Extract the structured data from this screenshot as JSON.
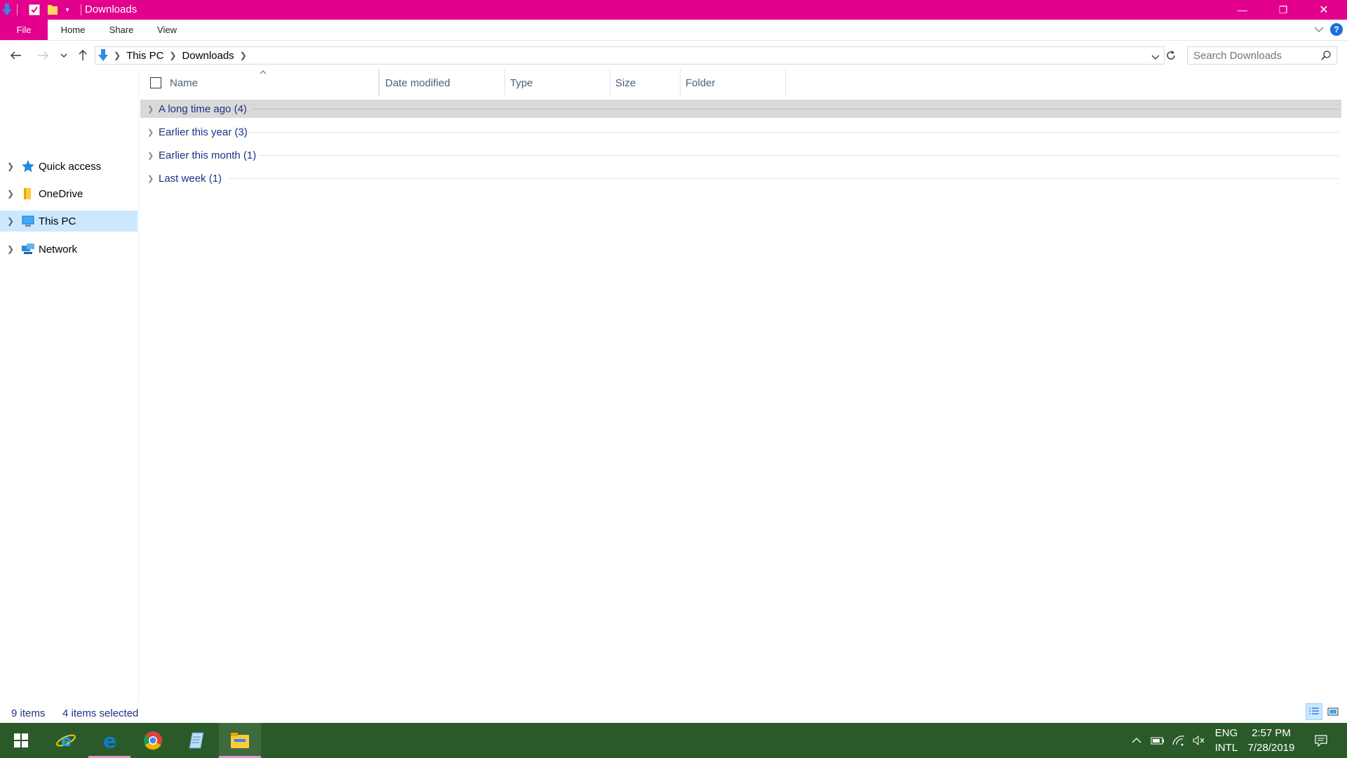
{
  "window": {
    "title": "Downloads",
    "minimize_glyph": "—",
    "restore_glyph": "❐",
    "close_glyph": "✕"
  },
  "ribbon": {
    "tabs": [
      "File",
      "Home",
      "Share",
      "View"
    ],
    "accent": "#e3008c"
  },
  "address": {
    "crumbs": [
      "This PC",
      "Downloads"
    ],
    "search_placeholder": "Search Downloads"
  },
  "nav": {
    "items": [
      {
        "label": "Quick access",
        "icon": "star-icon",
        "selected": false
      },
      {
        "label": "OneDrive",
        "icon": "onedrive-folder-icon",
        "selected": false
      },
      {
        "label": "This PC",
        "icon": "computer-icon",
        "selected": true
      },
      {
        "label": "Network",
        "icon": "network-icon",
        "selected": false
      }
    ]
  },
  "columns": {
    "name": "Name",
    "date_modified": "Date modified",
    "type": "Type",
    "size": "Size",
    "folder": "Folder"
  },
  "groups": [
    {
      "label": "A long time ago (4)",
      "selected": true
    },
    {
      "label": "Earlier this year (3)",
      "selected": false
    },
    {
      "label": "Earlier this month (1)",
      "selected": false
    },
    {
      "label": "Last week (1)",
      "selected": false
    }
  ],
  "status": {
    "item_count": "9 items",
    "selection": "4 items selected"
  },
  "taskbar": {
    "apps": [
      "start-icon",
      "internet-explorer-icon",
      "edge-icon",
      "chrome-icon",
      "notepad-icon",
      "file-explorer-icon"
    ],
    "lang_top": "ENG",
    "lang_bottom": "INTL",
    "time": "2:57 PM",
    "date": "7/28/2019",
    "color": "#2a5a2a"
  }
}
